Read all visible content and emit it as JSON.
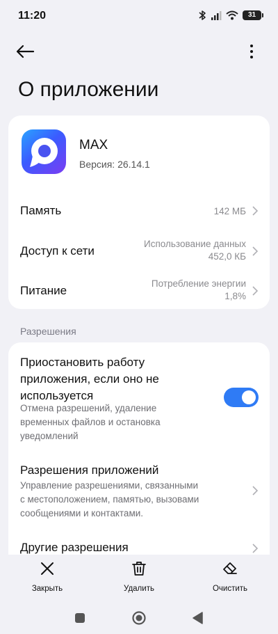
{
  "status": {
    "time": "11:20",
    "battery": "31"
  },
  "header": {
    "title": "О приложении"
  },
  "app": {
    "name": "MAX",
    "version": "Версия: 26.14.1"
  },
  "info_rows": [
    {
      "label": "Память",
      "value": "142 МБ"
    },
    {
      "label": "Доступ к сети",
      "value_line1": "Использование данных",
      "value_line2": "452,0 КБ"
    },
    {
      "label": "Питание",
      "value_line1": "Потребление энергии",
      "value_line2": "1,8%"
    }
  ],
  "permissions": {
    "section_title": "Разрешения",
    "pause": {
      "title_lines": [
        "Приостановить работу",
        "приложения, если оно не",
        "используется"
      ],
      "desc_lines": [
        "Отмена разрешений, удаление",
        "временных файлов и остановка",
        "уведомлений"
      ],
      "enabled": true
    },
    "app_permissions": {
      "title": "Разрешения приложений",
      "desc_lines": [
        "Управление разрешениями, связанными",
        "с местоположением, памятью, вызовами",
        "сообщениями и контактами."
      ]
    },
    "other": {
      "title": "Другие разрешения"
    }
  },
  "actions": {
    "close": "Закрыть",
    "delete": "Удалить",
    "clear": "Очистить"
  },
  "colors": {
    "accent": "#2f7bf5",
    "background": "#f1f1f6",
    "card": "#ffffff"
  }
}
